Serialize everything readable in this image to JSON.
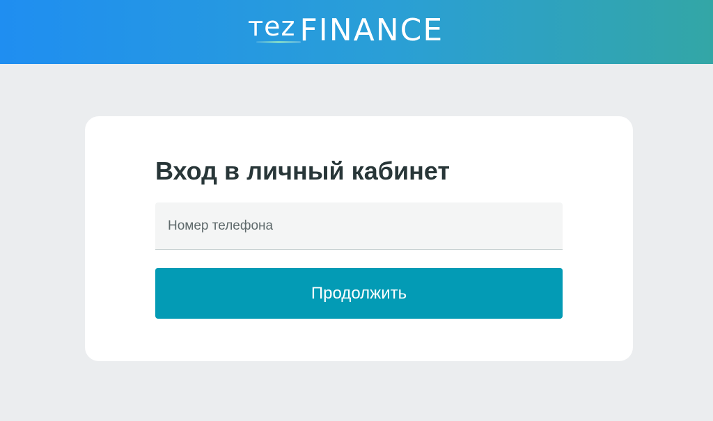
{
  "header": {
    "logo": {
      "part1": "тez",
      "part2": "FINANCE"
    },
    "colors": {
      "gradient_start": "#1f8ef1",
      "gradient_end": "#33a6a6"
    }
  },
  "login": {
    "title": "Вход в личный кабинет",
    "phone_placeholder": "Номер телефона",
    "continue_label": "Продолжить",
    "button_color": "#039bb5"
  }
}
